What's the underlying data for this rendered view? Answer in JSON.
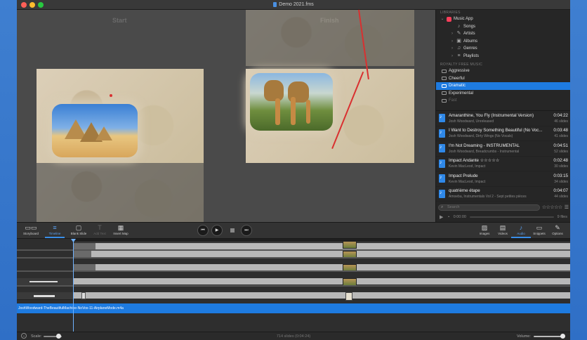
{
  "window": {
    "title": "Demo 2021.fms"
  },
  "preview": {
    "start_label": "Start",
    "finish_label": "Finish"
  },
  "sources": {
    "header_music": "LIBRARIES",
    "music_app": "Music App",
    "music_items": [
      "Songs",
      "Artists",
      "Albums",
      "Genres",
      "Playlists"
    ],
    "header_royalty": "ROYALTY FREE MUSIC",
    "royalty_items": [
      "Aggressive",
      "Cheerful",
      "Dramatic",
      "Experimental",
      "Fast"
    ],
    "selected": "Dramatic"
  },
  "tracks": [
    {
      "title": "Amaranthine, You Fly (Instrumental Version)",
      "artist": "Josh Woodward, Unreleased",
      "duration": "0:04:22",
      "slides": "46 slides"
    },
    {
      "title": "I Want to Destroy Something Beautiful (No Voc...",
      "artist": "Josh Woodward, Dirty Wings (No Vocals)",
      "duration": "0:03:48",
      "slides": "41 slides"
    },
    {
      "title": "I'm Not Dreaming - INSTRUMENTAL",
      "artist": "Josh Woodward, Breadcrumbs - Instrumental",
      "duration": "0:04:51",
      "slides": "52 slides"
    },
    {
      "title": "Impact Andante ☆☆☆☆☆",
      "artist": "Kevin MacLeod, Impact",
      "duration": "0:02:48",
      "slides": "30 slides"
    },
    {
      "title": "Impact Prelude",
      "artist": "Kevin MacLeod, Impact",
      "duration": "0:03:15",
      "slides": "34 slides"
    },
    {
      "title": "quatrième étape",
      "artist": "Amoeba, Instrumentals Vol 2 - Sept petites pièces",
      "duration": "0:04:07",
      "slides": "44 slides"
    }
  ],
  "search": {
    "placeholder": "Search",
    "stars": "☆☆☆☆☆",
    "time": "0:00:00",
    "files": "9 files"
  },
  "toolbar": {
    "storyboard": "Storyboard",
    "timeline": "Timeline",
    "blank_slide": "Blank Slide",
    "add_text": "Add Text",
    "insert_map": "Insert Map",
    "images": "Images",
    "videos": "Videos",
    "audio": "Audio",
    "snippets": "Snippets",
    "options": "Options"
  },
  "timeline": {
    "audio_file": "JoshWoodward-TheBeautifulMachine-NoVox-11-AirplaneMode.m4a"
  },
  "status": {
    "scale_label": "Scale:",
    "summary": "714 slides (0:04:24)",
    "volume_label": "Volume:"
  },
  "colors": {
    "accent": "#1e7be0",
    "route": "#d93030"
  }
}
